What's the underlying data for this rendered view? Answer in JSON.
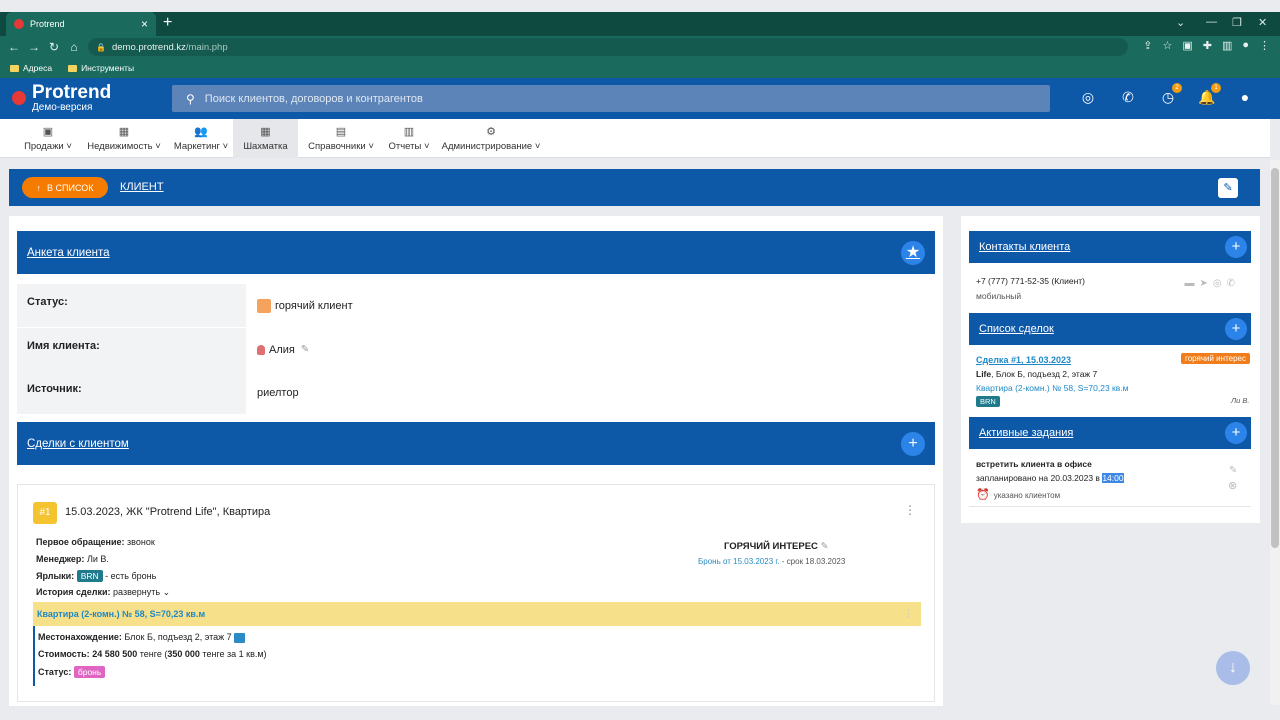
{
  "browser": {
    "tab_title": "Protrend",
    "url_host": "demo.protrend.kz",
    "url_path": "/main.php",
    "bookmarks": [
      "Адреса",
      "Инструменты"
    ]
  },
  "header": {
    "logo": "Protrend",
    "logo_sub": "Демо-версия",
    "search_placeholder": "Поиск клиентов, договоров и контрагентов",
    "badges": {
      "clock": "2",
      "bell": "1"
    }
  },
  "menu": [
    "Продажи",
    "Недвижимость",
    "Маркетинг",
    "Шахматка",
    "Справочники",
    "Отчеты",
    "Администрирование"
  ],
  "titlebar": {
    "back": "В СПИСОК",
    "title": "КЛИЕНТ"
  },
  "client": {
    "section": "Анкета клиента",
    "status_label": "Статус:",
    "status_value": "горячий клиент",
    "name_label": "Имя клиента:",
    "name_value": "Алия",
    "source_label": "Источник:",
    "source_value": "риелтор"
  },
  "deals_section": "Сделки с клиентом",
  "deal": {
    "num": "#1",
    "title": "15.03.2023, ЖК \"Protrend Life\", Квартира",
    "first_label": "Первое обращение:",
    "first_value": "звонок",
    "manager_label": "Менеджер:",
    "manager_value": "Ли В.",
    "tags_label": "Ярлыки:",
    "tag": "BRN",
    "tag_text": "- есть бронь",
    "history_label": "История сделки:",
    "history_value": "развернуть",
    "stage": "ГОРЯЧИЙ ИНТЕРЕС",
    "bron": "Бронь от 15.03.2023 г.",
    "srok": "срок 18.03.2023",
    "apartment": "Квартира (2-комн.) № 58, S=70,23 кв.м",
    "location_label": "Местонахождение:",
    "location_value": "Блок Б, подъезд 2, этаж 7",
    "cost_label": "Стоимость:",
    "cost_value": "24 580 500",
    "cost_currency": "тенге (",
    "cost_per": "350 000",
    "cost_per_text": "тенге за 1 кв.м)",
    "status_label": "Статус:",
    "status_value": "бронь"
  },
  "right": {
    "contacts_title": "Контакты клиента",
    "phone": "+7 (777) 771-52-35 (Клиент)",
    "phone_type": "мобильный",
    "deals_title": "Список сделок",
    "deal_link": "Сделка #1, 15.03.2023",
    "deal_badge": "горячий интерес",
    "deal_project": "Life",
    "deal_location": ", Блок Б, подъезд 2, этаж 7",
    "deal_apartment": "Квартира (2-комн.) № 58, S=70,23 кв.м",
    "deal_tag": "BRN",
    "deal_manager": "Ли В.",
    "tasks_title": "Активные задания",
    "task_title": "встретить клиента в офисе",
    "task_planned": "запланировано на 20.03.2023 в",
    "task_time": "14:00",
    "task_note": "указано клиентом"
  }
}
